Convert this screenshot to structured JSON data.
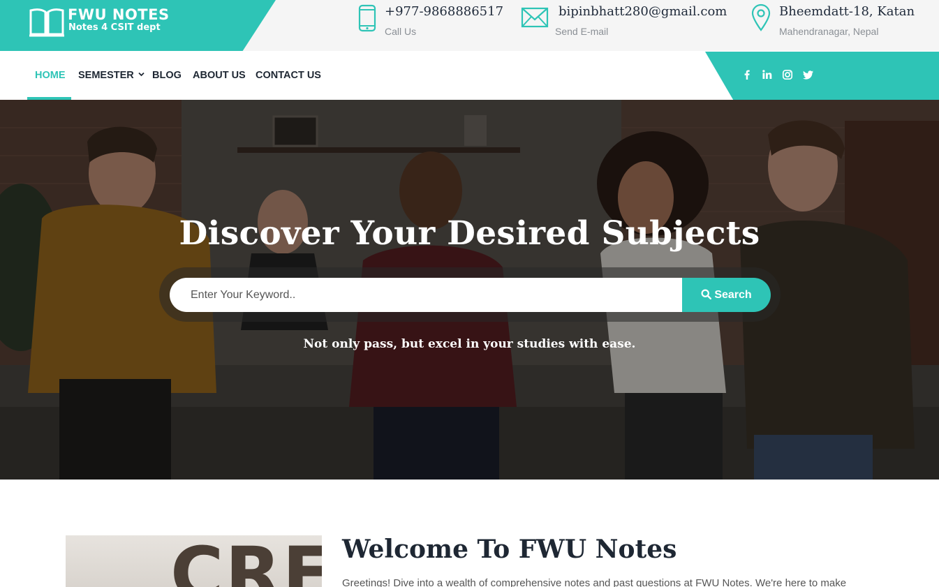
{
  "brand": {
    "title": "FWU NOTES",
    "subtitle": "Notes 4 CSIT dept",
    "logo_icon": "open-book-icon",
    "color": "#2ec4b6"
  },
  "contacts": [
    {
      "icon": "phone-icon",
      "main": "+977-9868886517",
      "sub": "Call Us"
    },
    {
      "icon": "mail-icon",
      "main": "bipinbhatt280@gmail.com",
      "sub": "Send E-mail"
    },
    {
      "icon": "location-pin-icon",
      "main": "Bheemdatt-18, Katan",
      "sub": "Mahendranagar, Nepal"
    }
  ],
  "nav": {
    "items": [
      {
        "label": "HOME",
        "active": true
      },
      {
        "label": "SEMESTER",
        "dropdown": true
      },
      {
        "label": "BLOG"
      },
      {
        "label": "ABOUT US"
      },
      {
        "label": "CONTACT US"
      }
    ],
    "social": [
      "facebook-icon",
      "linkedin-icon",
      "instagram-icon",
      "twitter-icon"
    ]
  },
  "hero": {
    "title": "Discover Your Desired Subjects",
    "search_placeholder": "Enter Your Keyword..",
    "search_button": "Search",
    "tagline": "Not only pass, but excel in your studies with ease."
  },
  "welcome": {
    "image_text": "CRF",
    "title": "Welcome To FWU Notes",
    "text": "Greetings! Dive into a wealth of comprehensive notes and past questions at FWU Notes. We're here to make"
  }
}
